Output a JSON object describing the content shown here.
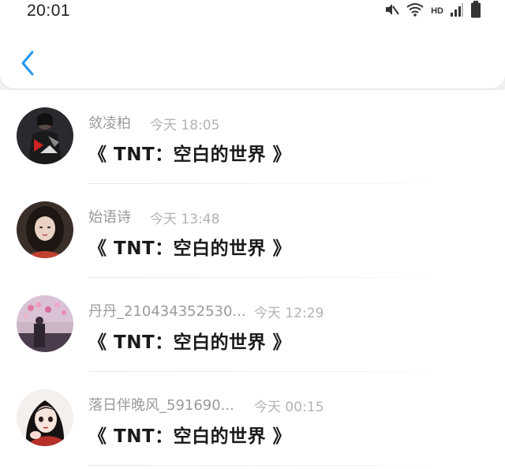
{
  "status_bar": {
    "time": "20:01",
    "network_label": "HD",
    "icons": [
      "mute-icon",
      "wifi-icon",
      "signal-icon",
      "battery-icon"
    ]
  },
  "nav": {
    "back_icon": "chevron-left-icon",
    "accent_color": "#2196f3"
  },
  "messages": [
    {
      "name": "敛凌柏",
      "time": "今天 18:05",
      "text": "《 TNT：空白的世界 》"
    },
    {
      "name": "始语诗",
      "time": "今天 13:48",
      "text": "《 TNT：空白的世界 》"
    },
    {
      "name": "丹丹_210434352530...",
      "time": "今天 12:29",
      "text": "《 TNT：空白的世界 》"
    },
    {
      "name": "落日伴晚风_591690...",
      "time": "今天 00:15",
      "text": "《 TNT：空白的世界 》"
    }
  ]
}
